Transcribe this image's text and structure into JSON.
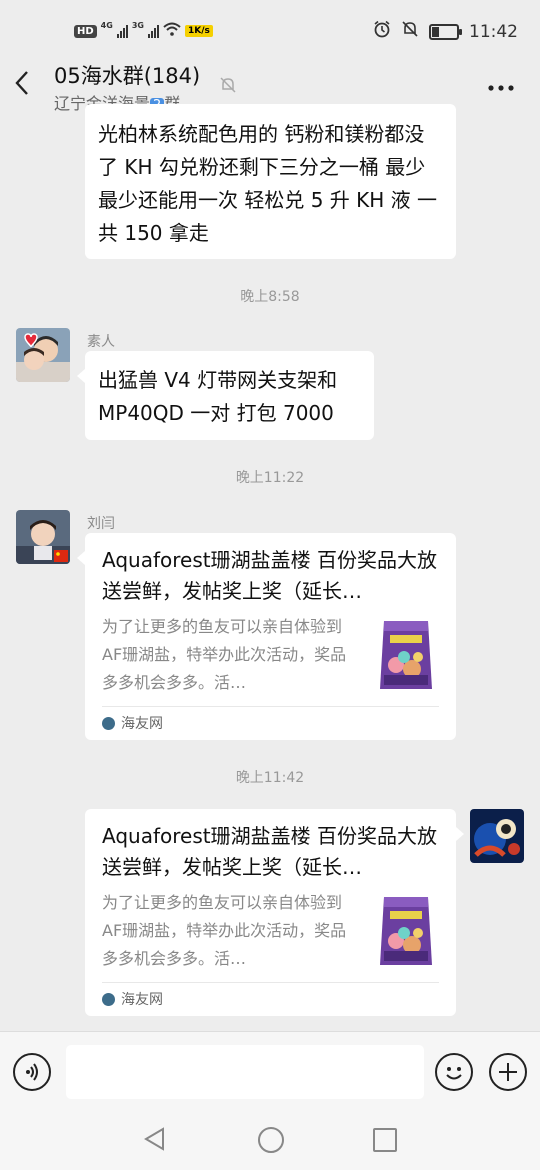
{
  "status_bar": {
    "hd": "HD",
    "signal1_label": "4G",
    "signal2_label": "3G",
    "kb_badge": "1K/s",
    "time": "11:42",
    "battery_level": 0.25
  },
  "header": {
    "title": "05海水群(184)",
    "subtitle": "辽宁金洋海景",
    "subtitle_badge": "2",
    "subtitle_suffix": "群"
  },
  "messages": [
    {
      "type": "text",
      "text": "光柏林系统配色用的 钙粉和镁粉都没了 KH 勾兑粉还剩下三分之一桶 最少最少还能用一次 轻松兑 5 升 KH 液  一共 150 拿走"
    },
    {
      "type": "time",
      "text": "晚上8:58"
    },
    {
      "type": "text",
      "sender": "素人",
      "text": "出猛兽 V4 灯带网关支架和 MP40QD 一对 打包 7000"
    },
    {
      "type": "time",
      "text": "晚上11:22"
    },
    {
      "type": "card",
      "sender": "刘闫",
      "title": "Aquaforest珊湖盐盖楼 百份奖品大放送尝鲜，发帖奖上奖（延长…",
      "desc": "为了让更多的鱼友可以亲自体验到AF珊湖盐，特举办此次活动，奖品多多机会多多。活…",
      "source": "海友网"
    },
    {
      "type": "time",
      "text": "晚上11:42"
    },
    {
      "type": "card",
      "sender": "",
      "title": "Aquaforest珊湖盐盖楼 百份奖品大放送尝鲜，发帖奖上奖（延长…",
      "desc": "为了让更多的鱼友可以亲自体验到AF珊湖盐，特举办此次活动，奖品多多机会多多。活…",
      "source": "海友网"
    }
  ],
  "colors": {
    "background": "#ededed",
    "bubble": "#ffffff",
    "timestamp": "#999999",
    "source_icon": "#3d6c8a"
  }
}
